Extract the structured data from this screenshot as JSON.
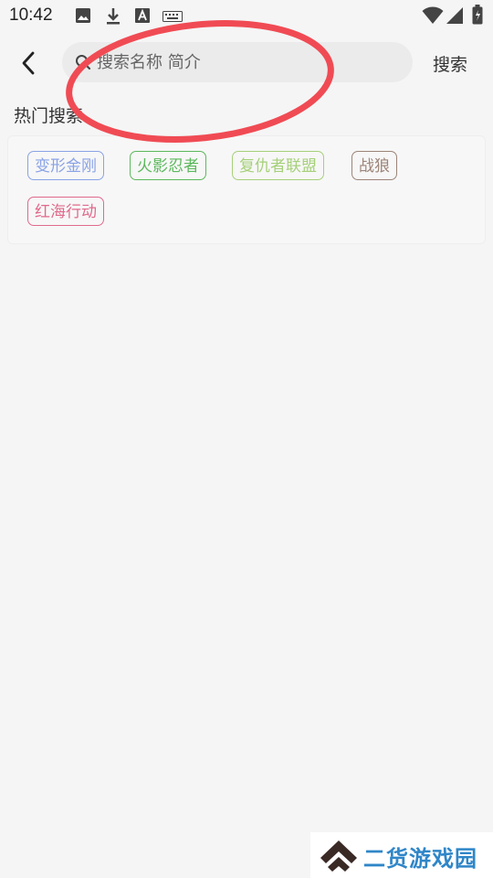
{
  "status_bar": {
    "time": "10:42",
    "icons": [
      "image-icon",
      "download-icon",
      "a-icon",
      "keyboard-icon",
      "wifi-icon",
      "signal-icon",
      "battery-icon"
    ]
  },
  "header": {
    "back_icon": "chevron-left-icon",
    "search_placeholder": "搜索名称 简介",
    "search_button_label": "搜索"
  },
  "hot_search": {
    "title": "热门搜索",
    "tags": [
      {
        "label": "变形金刚",
        "color": "#8aa3e6"
      },
      {
        "label": "火影忍者",
        "color": "#5cb85c"
      },
      {
        "label": "复仇者联盟",
        "color": "#a6d07a"
      },
      {
        "label": "战狼",
        "color": "#9c8478"
      },
      {
        "label": "红海行动",
        "color": "#e06a8c"
      }
    ]
  },
  "annotation": {
    "color": "#f04b54"
  },
  "watermark": {
    "text": "二货游戏园"
  }
}
